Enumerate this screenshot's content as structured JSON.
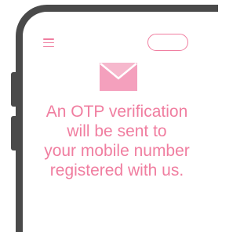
{
  "colors": {
    "accent": "#f07ea0",
    "phone_frame": "#4a4a4a",
    "background": "#ffffff"
  },
  "header": {
    "menu_icon": "hamburger-menu-icon",
    "pill_button_label": ""
  },
  "main": {
    "icon": "envelope-icon",
    "message_lines": [
      "An OTP verification",
      "will be sent to",
      "your mobile number",
      "registered with us."
    ]
  }
}
